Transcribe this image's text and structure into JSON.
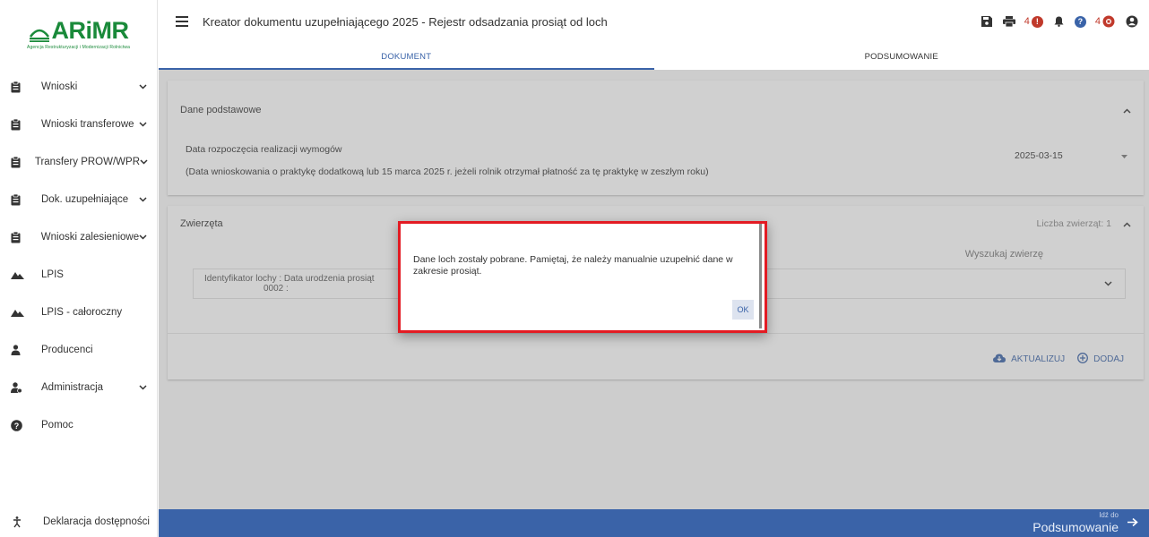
{
  "logo": {
    "text": "ARiMR",
    "subtitle": "Agencja Restrukturyzacji i Modernizacji Rolnictwa"
  },
  "sidebar": {
    "items": [
      {
        "label": "Wnioski",
        "icon": "clipboard-icon",
        "has_chevron": true
      },
      {
        "label": "Wnioski transferowe",
        "icon": "clipboard-icon",
        "has_chevron": true
      },
      {
        "label": "Transfery PROW/WPR",
        "icon": "clipboard-icon",
        "has_chevron": true
      },
      {
        "label": "Dok. uzupełniające",
        "icon": "clipboard-icon",
        "has_chevron": true
      },
      {
        "label": "Wnioski zalesieniowe",
        "icon": "clipboard-icon",
        "has_chevron": true
      },
      {
        "label": "LPIS",
        "icon": "mountains-icon",
        "has_chevron": false
      },
      {
        "label": "LPIS - całoroczny",
        "icon": "mountains-icon",
        "has_chevron": false
      },
      {
        "label": "Producenci",
        "icon": "user-icon",
        "has_chevron": false
      },
      {
        "label": "Administracja",
        "icon": "admin-icon",
        "has_chevron": true
      },
      {
        "label": "Pomoc",
        "icon": "help-icon",
        "has_chevron": false
      }
    ],
    "declaration": "Deklaracja dostępności"
  },
  "header": {
    "title": "Kreator dokumentu uzupełniającego 2025 - Rejestr odsadzania prosiąt od loch",
    "alerts_count": "4",
    "messages_count": "4"
  },
  "tabs": [
    {
      "label": "DOKUMENT",
      "active": true
    },
    {
      "label": "PODSUMOWANIE",
      "active": false
    }
  ],
  "basic_data": {
    "title": "Dane podstawowe",
    "start_label": "Data rozpoczęcia realizacji wymogów",
    "start_note": "(Data wnioskowania o praktykę dodatkową lub 15 marca 2025 r. jeżeli rolnik otrzymał płatność za tę praktykę w zeszłym roku)",
    "start_date": "2025-03-15"
  },
  "animals": {
    "title": "Zwierzęta",
    "count_label": "Liczba zwierząt: 1",
    "search_placeholder": "Wyszukaj zwierzę",
    "row_label_line1": "Identyfikator lochy : Data urodzenia prosiąt",
    "row_label_line2_suffix": "0002 :",
    "actions": {
      "update": "AKTUALIZUJ",
      "add": "DODAJ"
    }
  },
  "dialog": {
    "message": "Dane loch zostały pobrane. Pamiętaj, że należy manualnie uzupełnić dane w zakresie prosiąt.",
    "ok": "OK"
  },
  "footer": {
    "goto_small": "Idź do",
    "goto_big": "Podsumowanie"
  },
  "colors": {
    "brand_green": "#1a8a3a",
    "primary_blue": "#3a63a8",
    "alert_red": "#c0392b",
    "dialog_border": "#e31b23"
  }
}
